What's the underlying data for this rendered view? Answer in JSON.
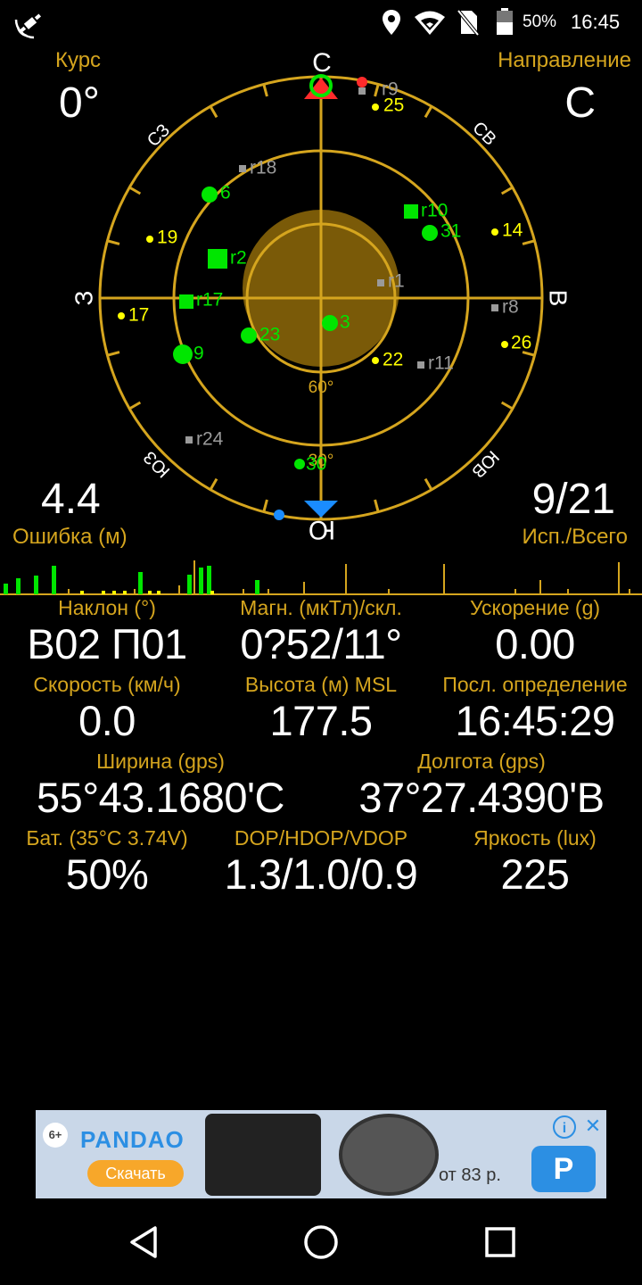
{
  "statusbar": {
    "battery_percent": "50%",
    "time": "16:45",
    "icons": [
      "satellite-signal-icon",
      "location-icon",
      "wifi-icon",
      "no-sim-icon",
      "battery-icon"
    ]
  },
  "course": {
    "label": "Курс",
    "value": "0°"
  },
  "direction": {
    "label": "Направление",
    "value": "С"
  },
  "error": {
    "value": "4.4",
    "label": "Ошибка (м)"
  },
  "satellites_count": {
    "value": "9/21",
    "label": "Исп./Всего"
  },
  "radar": {
    "cardinals": {
      "north": "С",
      "south": "Ю",
      "west": "З",
      "east": "В"
    },
    "intercardinals": {
      "nw": "СЗ",
      "ne": "СВ",
      "sw": "ЮЗ",
      "se": "ЮВ"
    },
    "elevation_labels": {
      "inner": "60°",
      "outer": "30°"
    },
    "satellites": [
      {
        "id": "r9",
        "type": "gray-square"
      },
      {
        "id": "25",
        "type": "yellow-dot"
      },
      {
        "id": "r18",
        "type": "gray-square"
      },
      {
        "id": "6",
        "type": "green-circle"
      },
      {
        "id": "r10",
        "type": "green-square"
      },
      {
        "id": "31",
        "type": "green-circle"
      },
      {
        "id": "19",
        "type": "yellow-dot"
      },
      {
        "id": "14",
        "type": "yellow-dot"
      },
      {
        "id": "r2",
        "type": "green-square"
      },
      {
        "id": "r1",
        "type": "gray-square"
      },
      {
        "id": "r17",
        "type": "green-square"
      },
      {
        "id": "17",
        "type": "yellow-dot"
      },
      {
        "id": "r8",
        "type": "gray-square"
      },
      {
        "id": "3",
        "type": "green-circle"
      },
      {
        "id": "23",
        "type": "green-circle"
      },
      {
        "id": "26",
        "type": "yellow-dot"
      },
      {
        "id": "9",
        "type": "green-circle"
      },
      {
        "id": "22",
        "type": "yellow-dot"
      },
      {
        "id": "r11",
        "type": "gray-square"
      },
      {
        "id": "r24",
        "type": "gray-square"
      },
      {
        "id": "30",
        "type": "green-circle"
      }
    ]
  },
  "readings": [
    {
      "label": "Наклон (°)",
      "value": "В02 П01"
    },
    {
      "label": "Магн. (мкТл)/скл.",
      "value": "0?52/11°"
    },
    {
      "label": "Ускорение (g)",
      "value": "0.00"
    },
    {
      "label": "Скорость (км/ч)",
      "value": "0.0"
    },
    {
      "label": "Высота (м) MSL",
      "value": "177.5"
    },
    {
      "label": "Посл. определение",
      "value": "16:45:29"
    },
    {
      "label": "Ширина (gps)",
      "value": "55°43.1680'С"
    },
    {
      "label": "Долгота (gps)",
      "value": "37°27.4390'В"
    },
    {
      "label": "Бат. (35°C 3.74V)",
      "value": "50%"
    },
    {
      "label": "DOP/HDOP/VDOP",
      "value": "1.3/1.0/0.9"
    },
    {
      "label": "Яркость (lux)",
      "value": "225"
    }
  ],
  "ad": {
    "badge": "6+",
    "brand": "PANDAO",
    "button": "Скачать",
    "price": "от 83 р.",
    "close": "✕",
    "info": "i"
  },
  "navbar": {
    "icons": [
      "back-icon",
      "home-icon",
      "recents-icon"
    ]
  },
  "colors": {
    "gold": "#d5a51e",
    "green": "#00e600",
    "yellow": "#ffff00",
    "gray": "#9a9a9a",
    "red": "#ff2b2b",
    "blue": "#1a8cff"
  }
}
